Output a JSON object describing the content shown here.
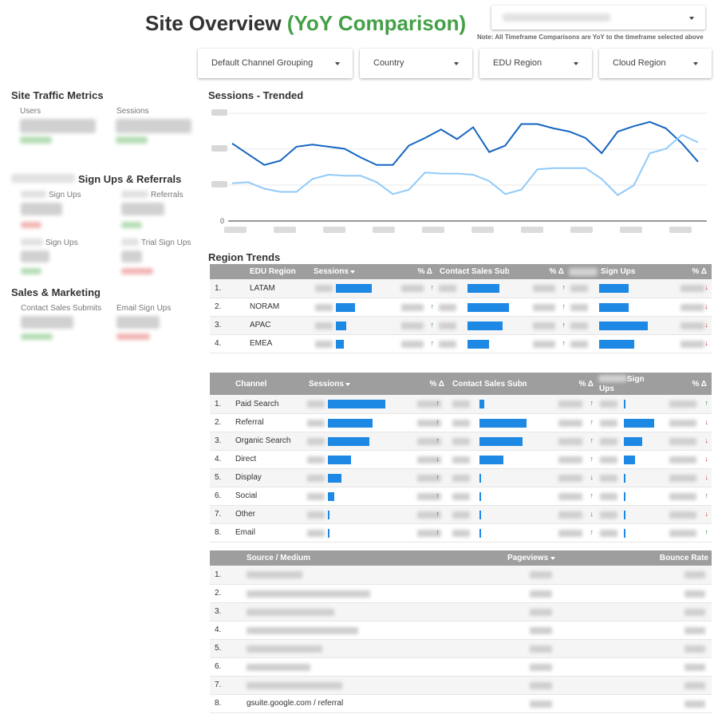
{
  "header": {
    "title_main": "Site Overview",
    "title_accent": "(YoY Comparison)",
    "note": "Note: All Timeframe Comparisons are YoY to the timeframe selected above"
  },
  "filters": [
    "Default Channel Grouping",
    "Country",
    "EDU Region",
    "Cloud Region"
  ],
  "left": {
    "site_traffic_title": "Site Traffic Metrics",
    "users_label": "Users",
    "sessions_label": "Sessions",
    "signups_title": "Sign Ups & Referrals",
    "signups_label_1": "Sign Ups",
    "referrals_label": "Referrals",
    "signups_label_2": "Sign Ups",
    "trial_label": "Trial Sign Ups",
    "sales_title": "Sales & Marketing",
    "contact_label": "Contact Sales Submits",
    "email_label": "Email Sign Ups"
  },
  "sessions_chart": {
    "title": "Sessions - Trended",
    "y_zero": "0"
  },
  "chart_data": {
    "type": "line",
    "title": "Sessions - Trended",
    "xlabel": "",
    "ylabel": "",
    "ylim": [
      0,
      1
    ],
    "grid": true,
    "series": [
      {
        "color": "#1565c0",
        "values": [
          0.72,
          0.62,
          0.52,
          0.56,
          0.69,
          0.71,
          0.69,
          0.67,
          0.59,
          0.52,
          0.52,
          0.7,
          0.77,
          0.85,
          0.76,
          0.87,
          0.64,
          0.7,
          0.9,
          0.9,
          0.86,
          0.83,
          0.77,
          0.63,
          0.83,
          0.88,
          0.92,
          0.86,
          0.72,
          0.55
        ]
      },
      {
        "color": "#90caf9",
        "values": [
          0.35,
          0.36,
          0.3,
          0.27,
          0.27,
          0.39,
          0.43,
          0.42,
          0.42,
          0.36,
          0.25,
          0.29,
          0.45,
          0.44,
          0.44,
          0.43,
          0.37,
          0.25,
          0.29,
          0.48,
          0.49,
          0.49,
          0.49,
          0.39,
          0.24,
          0.33,
          0.63,
          0.67,
          0.8,
          0.73
        ]
      }
    ]
  },
  "region_trends": {
    "title": "Region Trends",
    "headers": [
      "EDU Region",
      "Sessions",
      "% Δ",
      "Contact Sales Submit",
      "% Δ",
      "Sign Ups",
      "% Δ"
    ],
    "rows": [
      {
        "idx": "1.",
        "region": "LATAM",
        "s": 0.78,
        "c": 0.52,
        "u": 0.54,
        "a1": "up",
        "a2": "up",
        "a3": "down"
      },
      {
        "idx": "2.",
        "region": "NORAM",
        "s": 0.42,
        "c": 1.0,
        "u": 0.54,
        "a1": "up",
        "a2": "up",
        "a3": "down"
      },
      {
        "idx": "3.",
        "region": "APAC",
        "s": 0.22,
        "c": 0.58,
        "u": 0.9,
        "a1": "up",
        "a2": "up",
        "a3": "down"
      },
      {
        "idx": "4.",
        "region": "EMEA",
        "s": 0.18,
        "c": 0.36,
        "u": 0.64,
        "a1": "up",
        "a2": "up",
        "a3": "down"
      }
    ]
  },
  "channel_table": {
    "headers": [
      "Channel",
      "Sessions",
      "% Δ",
      "Contact Sales Submit",
      "% Δ",
      "Sign",
      "Ups",
      "% Δ"
    ],
    "rows": [
      {
        "idx": "1.",
        "channel": "Paid Search",
        "s": 1.0,
        "c": 0.08,
        "u": 0.02,
        "a1": "up",
        "a2": "up",
        "a3": "up"
      },
      {
        "idx": "2.",
        "channel": "Referral",
        "s": 0.6,
        "c": 1.0,
        "u": 1.0,
        "a1": "up",
        "a2": "up",
        "a3": "down"
      },
      {
        "idx": "3.",
        "channel": "Organic Search",
        "s": 0.56,
        "c": 0.77,
        "u": 0.6,
        "a1": "up",
        "a2": "up",
        "a3": "down"
      },
      {
        "idx": "4.",
        "channel": "Direct",
        "s": 0.31,
        "c": 0.43,
        "u": 0.38,
        "a1": "down",
        "a2": "up",
        "a3": "down"
      },
      {
        "idx": "5.",
        "channel": "Display",
        "s": 0.18,
        "c": 0.02,
        "u": 0.02,
        "a1": "up",
        "a2": "down",
        "a3": "down"
      },
      {
        "idx": "6.",
        "channel": "Social",
        "s": 0.09,
        "c": 0.02,
        "u": 0.02,
        "a1": "up",
        "a2": "up",
        "a3": "up"
      },
      {
        "idx": "7.",
        "channel": "Other",
        "s": 0.02,
        "c": 0.02,
        "u": 0.02,
        "a1": "up",
        "a2": "down",
        "a3": "down"
      },
      {
        "idx": "8.",
        "channel": "Email",
        "s": 0.02,
        "c": 0.02,
        "u": 0.02,
        "a1": "up",
        "a2": "up",
        "a3": "up"
      }
    ]
  },
  "source_table": {
    "headers": [
      "Source / Medium",
      "Pageviews",
      "Bounce Rate"
    ],
    "rows": [
      "1.",
      "2.",
      "3.",
      "4.",
      "5.",
      "6.",
      "7.",
      "8."
    ],
    "last_visible_text": "gsuite.google.com / referral"
  },
  "colors": {
    "accent_green": "#43a047",
    "header_gray": "#9e9e9e",
    "bar_blue": "#1e88e5",
    "up_green": "#2e7d32",
    "down_red": "#d32f2f"
  }
}
